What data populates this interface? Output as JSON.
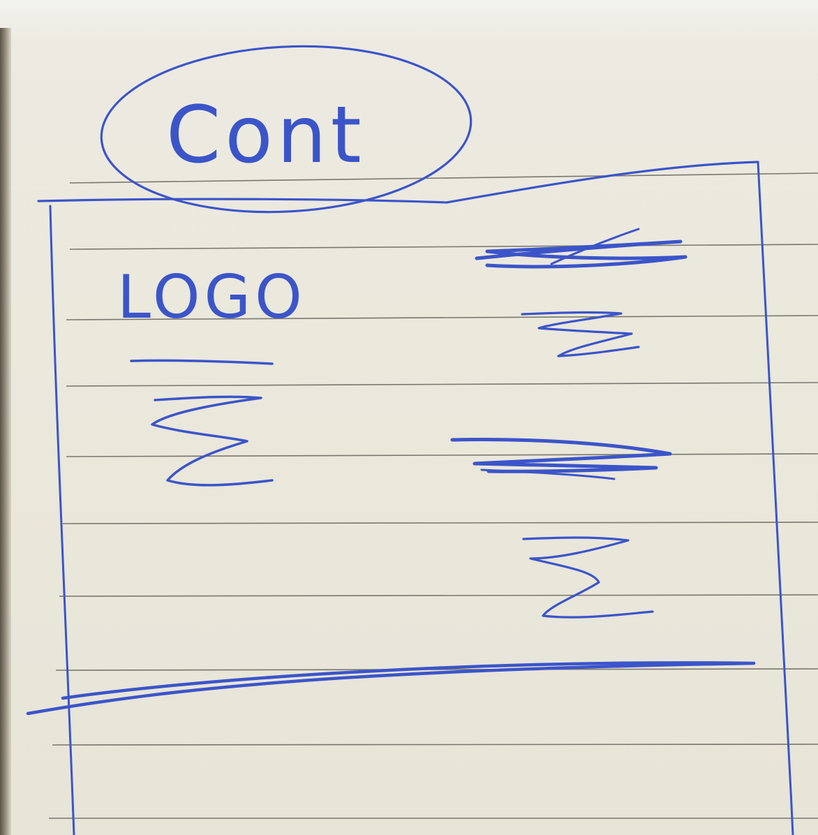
{
  "header": {
    "title": "Cont"
  },
  "brand": {
    "logo_label": "LOGO"
  },
  "colors": {
    "ink": "#3b55c9",
    "paper": "#ebe8dc",
    "rule": "#55524a"
  }
}
